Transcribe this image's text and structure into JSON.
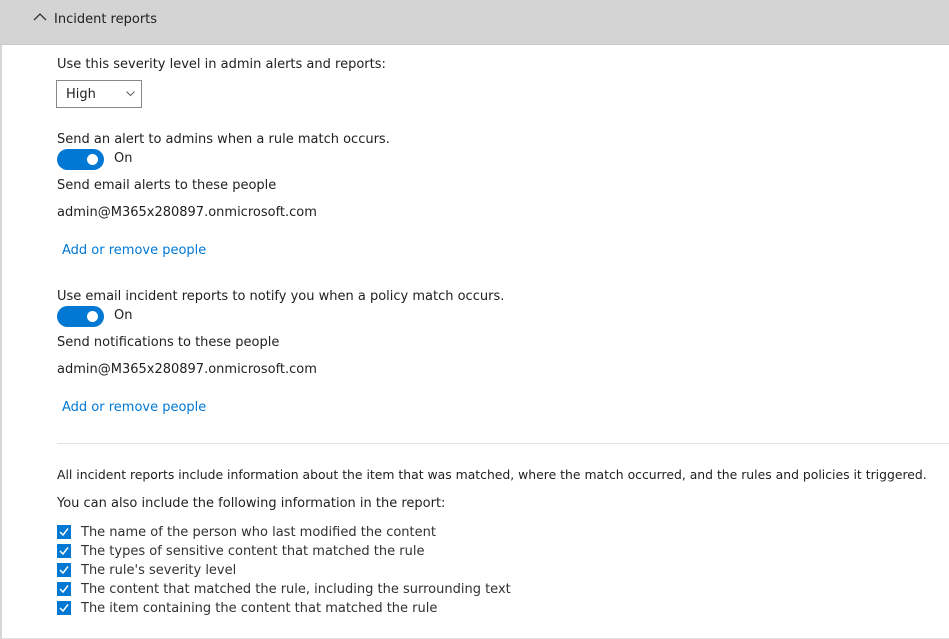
{
  "section": {
    "title": "Incident reports",
    "collapse_icon": "chevron-up-icon"
  },
  "severity": {
    "label": "Use this severity level in admin alerts and reports:",
    "selected": "High"
  },
  "alert": {
    "label": "Send an alert to admins when a rule match occurs.",
    "toggle_state": "On",
    "recipients_label": "Send email alerts to these people",
    "recipient": "admin@M365x280897.onmicrosoft.com",
    "link": "Add or remove people"
  },
  "incident": {
    "label": "Use email incident reports to notify you when a policy match occurs.",
    "toggle_state": "On",
    "recipients_label": "Send notifications to these people",
    "recipient": "admin@M365x280897.onmicrosoft.com",
    "link": "Add or remove people"
  },
  "report_info": {
    "summary": "All incident reports include information about the item that was matched, where the match occurred, and the rules and policies it triggered.",
    "include_label": "You can also include the following information in the report:",
    "options": [
      {
        "label": "The name of the person who last modified the content",
        "checked": true
      },
      {
        "label": "The types of sensitive content that matched the rule",
        "checked": true
      },
      {
        "label": "The rule's severity level",
        "checked": true
      },
      {
        "label": "The content that matched the rule, including the surrounding text",
        "checked": true
      },
      {
        "label": "The item containing the content that matched the rule",
        "checked": true
      }
    ]
  },
  "colors": {
    "accent": "#0078d4",
    "header_bg": "#d4d4d4"
  }
}
